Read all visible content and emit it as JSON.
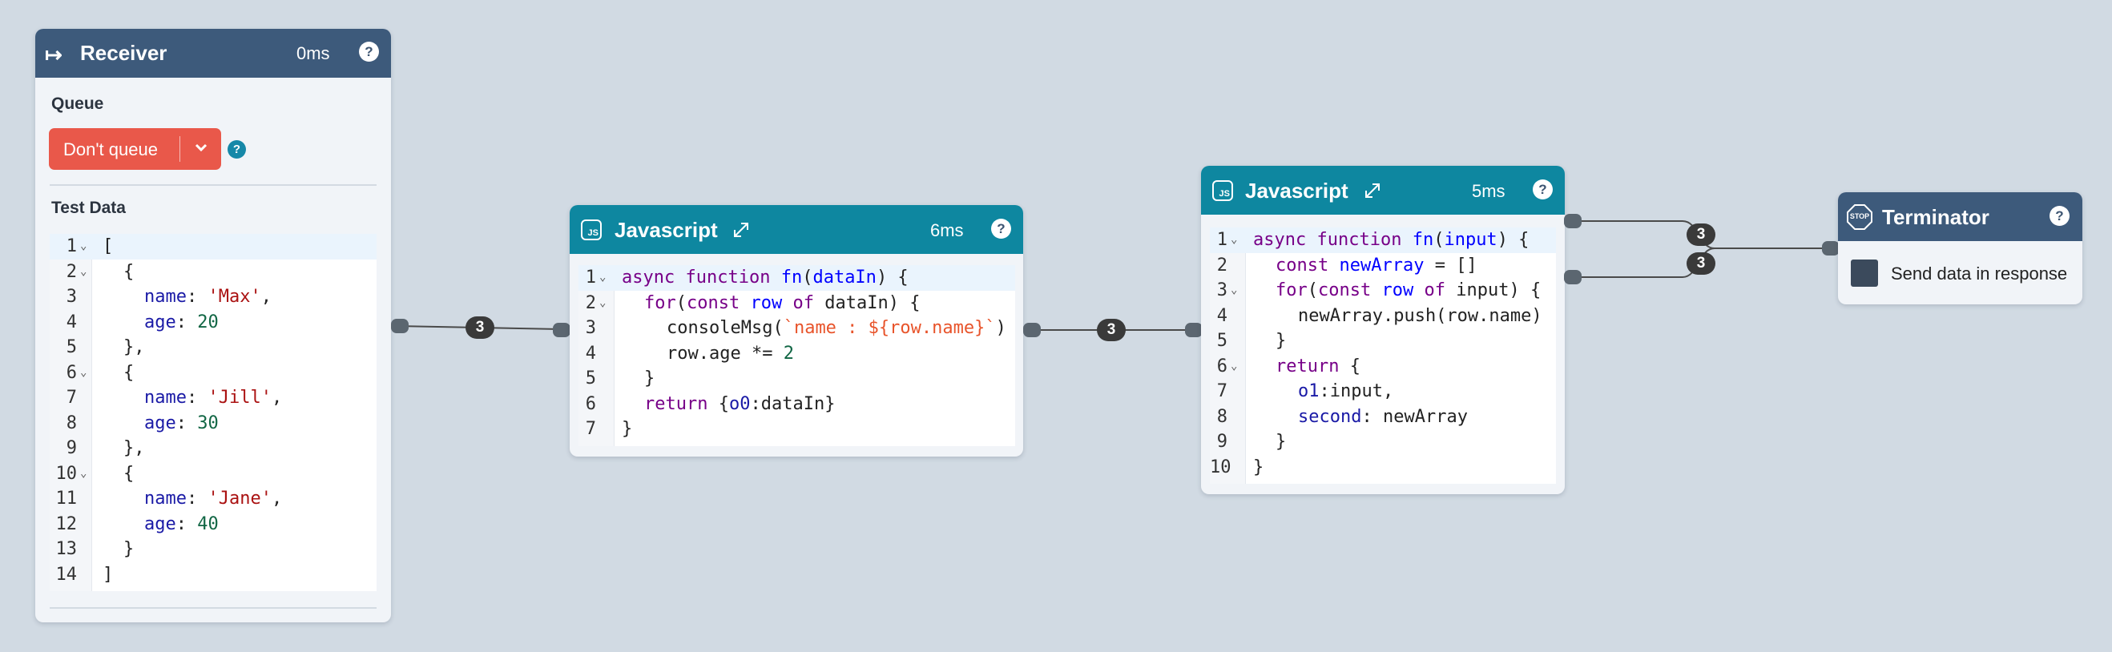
{
  "receiver": {
    "title": "Receiver",
    "time": "0ms",
    "help": "?",
    "queue_label": "Queue",
    "queue_button_label": "Don't queue",
    "queue_help": "?",
    "test_data_label": "Test Data",
    "lines": [
      "1",
      "2",
      "3",
      "4",
      "5",
      "6",
      "7",
      "8",
      "9",
      "10",
      "11",
      "12",
      "13",
      "14"
    ]
  },
  "js1": {
    "title": "Javascript",
    "badge": "JS",
    "time": "6ms",
    "help": "?",
    "lines": [
      "1",
      "2",
      "3",
      "4",
      "5",
      "6",
      "7"
    ]
  },
  "js2": {
    "title": "Javascript",
    "badge": "JS",
    "time": "5ms",
    "help": "?",
    "lines": [
      "1",
      "2",
      "3",
      "4",
      "5",
      "6",
      "7",
      "8",
      "9",
      "10"
    ]
  },
  "terminator": {
    "title": "Terminator",
    "icon_text": "STOP",
    "help": "?",
    "checkbox_label": "Send data in response"
  },
  "edges": {
    "receiver_to_js1": "3",
    "js1_to_js2": "3",
    "js2_out1": "3",
    "js2_out2": "3"
  },
  "code": {
    "receiver": {
      "open": "[",
      "brace_open": "{",
      "name_key": "name",
      "age_key": "age",
      "colon": ": ",
      "comma": ",",
      "name1": "'Max'",
      "age1": "20",
      "name2": "'Jill'",
      "age2": "30",
      "name3": "'Jane'",
      "age3": "40",
      "brace_close_comma": "},",
      "brace_close": "}",
      "close": "]"
    },
    "js1": {
      "async": "async",
      "function": "function",
      "fn": "fn",
      "param": "dataIn",
      "paren_close": ") {",
      "for": "for",
      "const": "const",
      "row": "row",
      "of": "of",
      "param2": "dataIn",
      "for_end": ") {",
      "console": "consoleMsg(",
      "tpl": "`name : ${row.name}`",
      "close_paren": ")",
      "row_age": "row.age *= ",
      "two": "2",
      "inner_close": "}",
      "return": "return",
      "ret_obj_open": "{",
      "o0": "o0",
      "ret_tail": ":dataIn}",
      "outer_close": "}"
    },
    "js2": {
      "async": "async",
      "function": "function",
      "fn": "fn",
      "param": "input",
      "paren_close": ") {",
      "const": "const",
      "newArray": "newArray",
      "assign": " = []",
      "for": "for",
      "row": "row",
      "of": "of",
      "param2": "input",
      "for_end": ") {",
      "push": "newArray.push(row.name)",
      "inner_close": "}",
      "return": "return",
      "ret_open": " {",
      "o1": "o1",
      "o1_tail": ":input,",
      "second": "second",
      "second_tail": ": newArray",
      "ret_close": "}",
      "outer_close": "}"
    }
  },
  "colors": {
    "receiver_header": "#3d5a7b",
    "js_header": "#0e87a0",
    "terminator_header": "#3d5a7b",
    "queue_button": "#e9584a",
    "canvas": "#d1dae3"
  }
}
